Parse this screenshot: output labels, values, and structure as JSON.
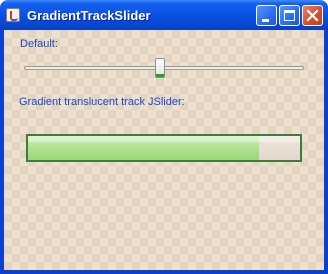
{
  "window": {
    "title": "GradientTrackSlider",
    "controls": [
      "minimize-icon",
      "maximize-icon",
      "close-icon"
    ],
    "titlebar_color": "#0a51e3"
  },
  "content": {
    "default_label": "Default:",
    "gradient_label": "Gradient translucent track JSlider:",
    "default_slider": {
      "value": 50,
      "min": 0,
      "max": 100
    },
    "gradient_slider": {
      "value": 85,
      "min": 0,
      "max": 100,
      "fill_color": "#a8df88"
    }
  }
}
